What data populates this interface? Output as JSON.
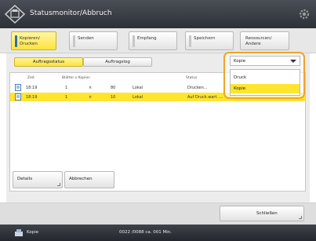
{
  "title": "Statusmonitor/Abbruch",
  "tabs": [
    {
      "label": "Kopieren/\nDrucken",
      "active": true
    },
    {
      "label": "Senden",
      "active": false
    },
    {
      "label": "Empfang",
      "active": false
    },
    {
      "label": "Speichern",
      "active": false
    },
    {
      "label": "Ressourcen/\nAndere",
      "active": false
    }
  ],
  "subtabs": {
    "status": "Auftragsstatus",
    "log": "Auftragslog"
  },
  "list": {
    "headers": {
      "time": "Zeit",
      "pages": "Blätter x Kopien",
      "status": "Status"
    },
    "rows": [
      {
        "time": "18:19",
        "sheets": "1",
        "x": "×",
        "copies": "80",
        "dest": "Lokal",
        "status": "Drucken...",
        "selected": false
      },
      {
        "time": "18:19",
        "sheets": "1",
        "x": "×",
        "copies": "10",
        "dest": "Lokal",
        "status": "Auf Druck.wart. ...",
        "selected": true
      }
    ]
  },
  "filter": {
    "selected": "Kopie",
    "options": [
      {
        "label": "Druck",
        "selected": false
      },
      {
        "label": "Kopie",
        "selected": true
      }
    ]
  },
  "buttons": {
    "details": "Details",
    "cancel": "Abbrechen",
    "close": "Schließen"
  },
  "statusbar": {
    "mode": "Kopie",
    "info": "0022 /0088  ca. 001 Min."
  },
  "colors": {
    "accent": "#ffe52e",
    "highlight": "#f2a32a",
    "titlebar": "#2c3037"
  },
  "icons": [
    "machine-logo-icon",
    "gear-icon",
    "document-icon",
    "chevron-down-icon",
    "copy-mode-icon"
  ]
}
